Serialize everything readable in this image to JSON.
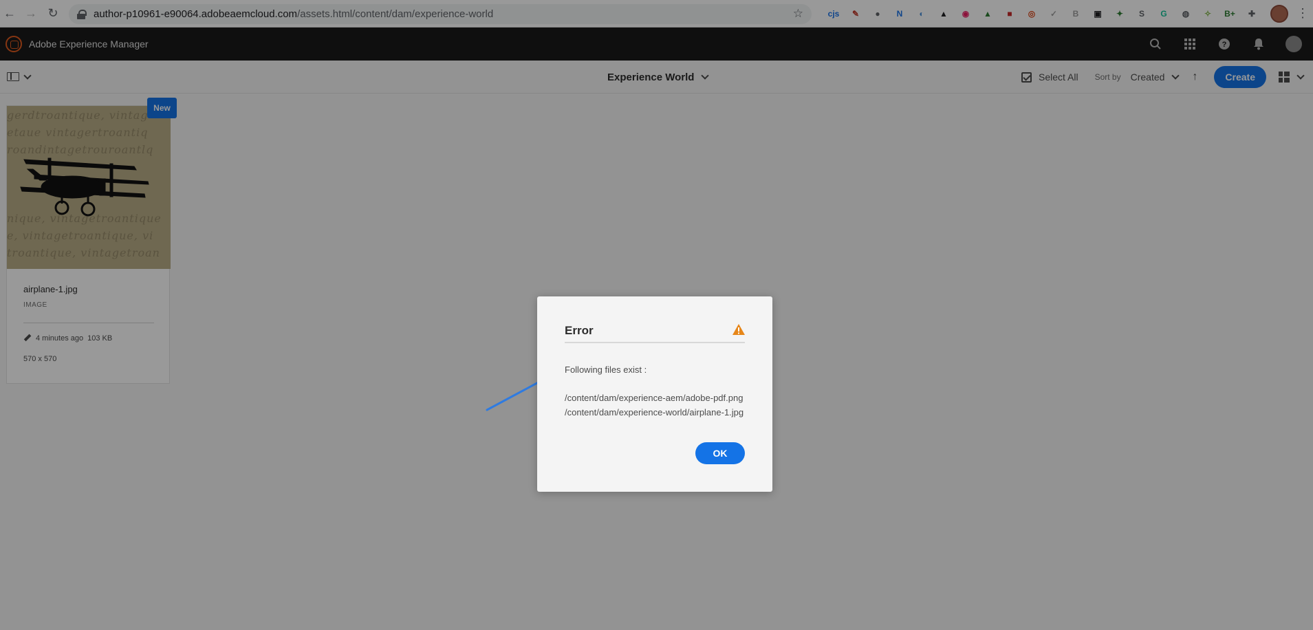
{
  "browser": {
    "url_host": "author-p10961-e90064.adobeaemcloud.com",
    "url_path": "/assets.html/content/dam/experience-world",
    "extensions": [
      {
        "name": "cjs-ext-icon",
        "text": "cjs",
        "color": "#1a73e8"
      },
      {
        "name": "pen-ext-icon",
        "text": "✎",
        "color": "#c0392b"
      },
      {
        "name": "circle-ext-icon",
        "text": "●",
        "color": "#5f6368"
      },
      {
        "name": "n-ext-icon",
        "text": "N",
        "color": "#1a73e8"
      },
      {
        "name": "compass-ext-icon",
        "text": "◐",
        "color": "#4a90d9"
      },
      {
        "name": "spy-ext-icon",
        "text": "▲",
        "color": "#202124"
      },
      {
        "name": "eye-ext-icon",
        "text": "◉",
        "color": "#e91e63"
      },
      {
        "name": "drive-ext-icon",
        "text": "▲",
        "color": "#2e7d32"
      },
      {
        "name": "red-box-ext-icon",
        "text": "■",
        "color": "#c62828"
      },
      {
        "name": "target-ext-icon",
        "text": "◎",
        "color": "#d84315"
      },
      {
        "name": "hand-ext-icon",
        "text": "✓",
        "color": "#9e9e9e"
      },
      {
        "name": "b-ext-icon",
        "text": "B",
        "color": "#9e9e9e"
      },
      {
        "name": "tab-ext-icon",
        "text": "▣",
        "color": "#202124"
      },
      {
        "name": "leaf-ext-icon",
        "text": "✦",
        "color": "#2e7d32"
      },
      {
        "name": "s-ext-icon",
        "text": "S",
        "color": "#5f6368"
      },
      {
        "name": "g-ext-icon",
        "text": "G",
        "color": "#15c39a"
      },
      {
        "name": "search-ext-icon",
        "text": "◍",
        "color": "#5f6368"
      },
      {
        "name": "pin-ext-icon",
        "text": "✧",
        "color": "#7cb342"
      },
      {
        "name": "b-plus-ext-icon",
        "text": "B+",
        "color": "#2e7d32"
      },
      {
        "name": "puzzle-ext-icon",
        "text": "✚",
        "color": "#5f6368"
      }
    ]
  },
  "header": {
    "app_title": "Adobe Experience Manager"
  },
  "toolbar": {
    "folder_title": "Experience World",
    "select_all_label": "Select All",
    "sort_by_label": "Sort by",
    "sort_by_value": "Created",
    "create_label": "Create"
  },
  "asset_card": {
    "badge": "New",
    "title": "airplane-1.jpg",
    "type": "IMAGE",
    "modified": "4 minutes ago",
    "size": "103 KB",
    "dimensions": "570 x 570",
    "thumb_script": [
      "gerdtroantique, vintag",
      "etaue vintagertroantiq",
      "roandintagetrouroantlq",
      "",
      "",
      "",
      "nique, vintagetroantique",
      "e, vintagetroantique, vi",
      "troantique, vintagetroan"
    ]
  },
  "dialog": {
    "title": "Error",
    "message": "Following files exist :",
    "files": [
      "/content/dam/experience-aem/adobe-pdf.png",
      "/content/dam/experience-world/airplane-1.jpg"
    ],
    "ok_label": "OK"
  },
  "colors": {
    "accent": "#1473e6",
    "warning": "#e68619",
    "annotation_arrow": "#2f7be0"
  }
}
